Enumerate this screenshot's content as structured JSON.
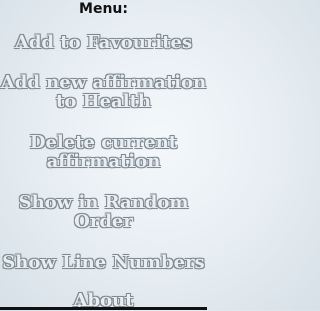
{
  "menu": {
    "title": "Menu:",
    "items": [
      {
        "label": "Add to Favourites"
      },
      {
        "label": "Add new affirmation to Health"
      },
      {
        "label": "Delete current affirmation"
      },
      {
        "label": "Show in Random Order"
      },
      {
        "label": "Show Line Numbers"
      },
      {
        "label": "About"
      }
    ]
  },
  "colors": {
    "background": "#e6edf2",
    "item_fill": "#e9eef2",
    "item_outline": "#7f8a92",
    "title": "#111111"
  }
}
